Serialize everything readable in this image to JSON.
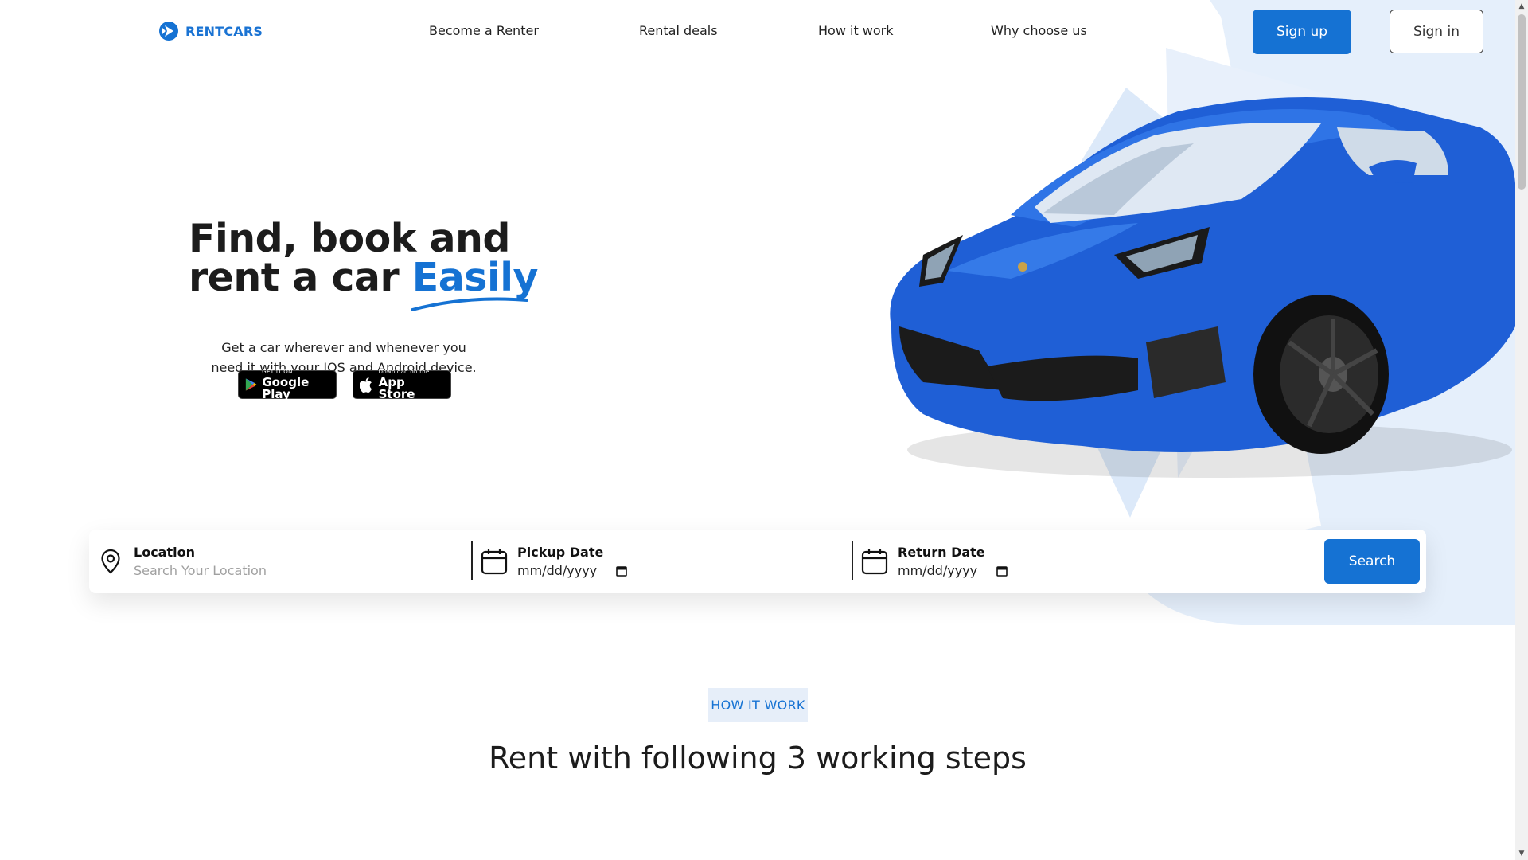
{
  "brand": {
    "name": "RENTCARS",
    "accent_color": "#1572d3"
  },
  "nav": {
    "links": [
      "Become a Renter",
      "Rental deals",
      "How it work",
      "Why choose us"
    ],
    "signup_label": "Sign up",
    "signin_label": "Sign in"
  },
  "hero": {
    "title_line1": "Find, book and",
    "title_line2_prefix": "rent a car ",
    "title_accent": "Easily",
    "subtitle": "Get a car wherever and whenever you need it with your IOS and Android device.",
    "google_play": {
      "small": "GET IT ON",
      "big": "Google Play"
    },
    "app_store": {
      "small": "Download on the",
      "big": "App Store"
    }
  },
  "search": {
    "location_label": "Location",
    "location_placeholder": "Search Your Location",
    "pickup_label": "Pickup Date",
    "pickup_value": "mm/dd/yyyy",
    "return_label": "Return Date",
    "return_value": "mm/dd/yyyy",
    "search_label": "Search"
  },
  "how_it_works": {
    "tag": "HOW IT WORK",
    "title": "Rent with following 3 working steps"
  }
}
